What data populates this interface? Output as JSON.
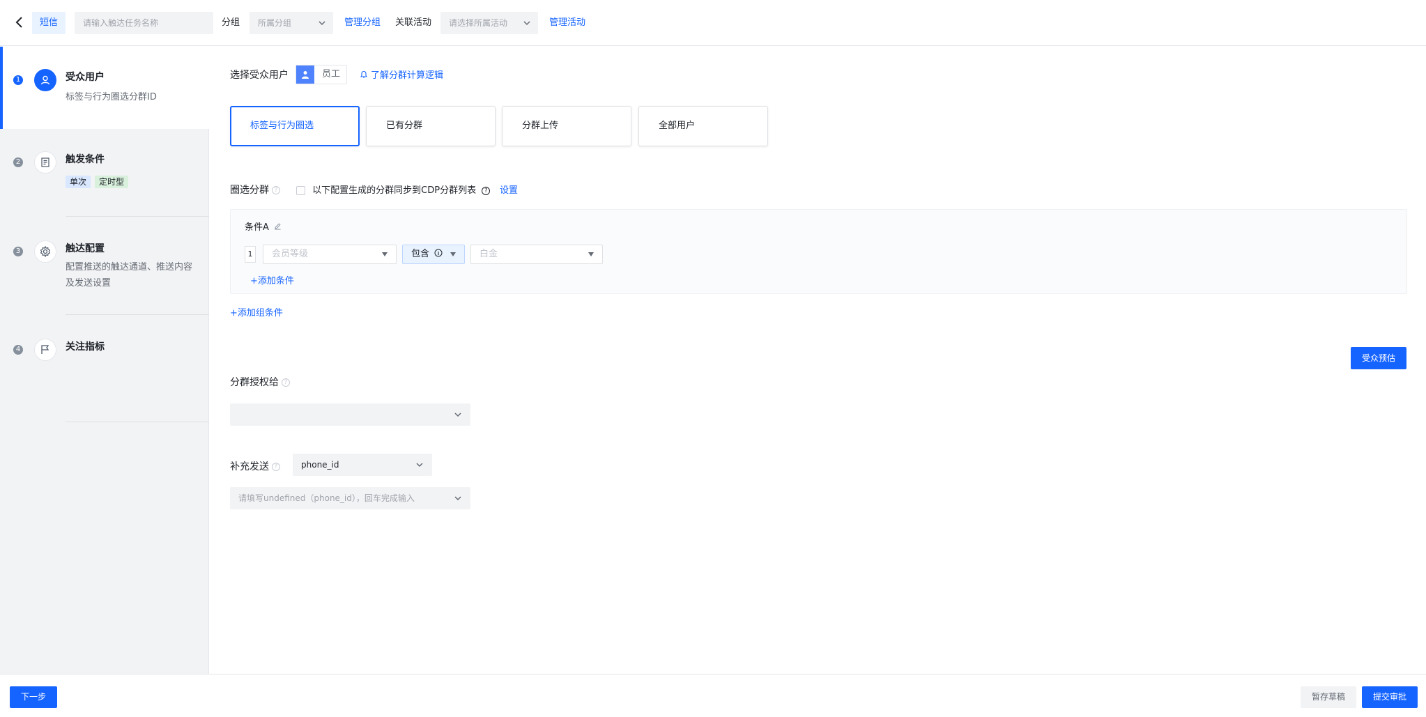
{
  "header": {
    "channel_tag": "短信",
    "task_name_placeholder": "请输入触达任务名称",
    "group_label": "分组",
    "group_placeholder": "所属分组",
    "manage_group_link": "管理分组",
    "related_activity_label": "关联活动",
    "activity_placeholder": "请选择所属活动",
    "manage_activity_link": "管理活动"
  },
  "sidebar": {
    "steps": [
      {
        "num": "1",
        "title": "受众用户",
        "desc": "标签与行为圈选分群ID",
        "icon": "user-icon"
      },
      {
        "num": "2",
        "title": "触发条件",
        "tags": [
          "单次",
          "定时型"
        ],
        "icon": "document-icon"
      },
      {
        "num": "3",
        "title": "触达配置",
        "desc": "配置推送的触达通道、推送内容及发送设置",
        "icon": "gear-icon"
      },
      {
        "num": "4",
        "title": "关注指标",
        "icon": "flag-icon"
      }
    ]
  },
  "main": {
    "audience_label": "选择受众用户",
    "employee_label": "员工",
    "learn_link": "了解分群计算逻辑",
    "mode_cards": [
      "标签与行为圈选",
      "已有分群",
      "分群上传",
      "全部用户"
    ],
    "selected_mode": "标签与行为圈选",
    "segment_label": "圈选分群",
    "sync_checkbox_label": "以下配置生成的分群同步到CDP分群列表",
    "settings_link": "设置",
    "condition_group_name": "条件A",
    "condition_row_index": "1",
    "condition_field_placeholder": "会员等级",
    "condition_operator": "包含",
    "condition_value_placeholder": "白金",
    "add_condition": "+添加条件",
    "add_group_condition": "+添加组条件",
    "estimate_button": "受众预估",
    "authorize_label": "分群授权给",
    "authorize_value": "",
    "supplement_label": "补充发送",
    "supplement_select": "phone_id",
    "supplement_input_placeholder": "请填写undefined（phone_id），回车完成输入"
  },
  "footer": {
    "next_button": "下一步",
    "save_draft_button": "暂存草稿",
    "submit_button": "提交审批"
  },
  "colors": {
    "accent": "#1664ff",
    "sidebar_bg": "#f2f3f5"
  }
}
